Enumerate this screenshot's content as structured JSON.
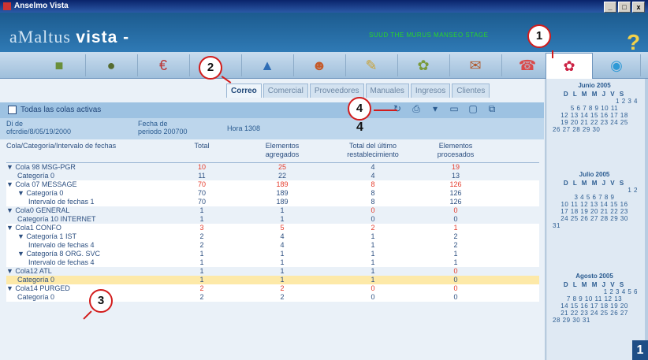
{
  "window": {
    "title": "Anselmo Vista",
    "buttons": [
      "_",
      "□",
      "x"
    ]
  },
  "header": {
    "brand_light": "aMaltus",
    "brand_bold": "vista -",
    "status_text": "SUUD THE MURUS MANSEO STAGE",
    "help": "?"
  },
  "icon_toolbar": {
    "icons": [
      "modules-icon",
      "globe-icon",
      "finance-icon",
      "folder-icon",
      "car-icon",
      "person-icon",
      "tools-icon",
      "settings-icon",
      "notes-icon",
      "calendar-icon",
      "world-icon"
    ]
  },
  "tabs": [
    "Correo",
    "Comercial",
    "Proveedores",
    "Manuales",
    "Ingresos",
    "Clientes"
  ],
  "filter_label": "Todas las colas activas",
  "info": {
    "col1": "Di de\nofcrdie/8/05/19/2000",
    "col2": "Fecha de\nperiodo 200700",
    "col3": "Hora 1308"
  },
  "table": {
    "headers": [
      "Cola/Categoría/Intervalo de fechas",
      "Total",
      "Elementos agregados",
      "Total del último restablecimiento",
      "Elementos procesados"
    ],
    "rows": [
      {
        "label": "▼ Cola 98 MSG-PGR",
        "level": 0,
        "vals": [
          "10",
          "25",
          "4",
          "19"
        ],
        "red": [
          true,
          true,
          false,
          true
        ],
        "bg": "none"
      },
      {
        "label": "Categoría 0",
        "level": 1,
        "vals": [
          "11",
          "22",
          "4",
          "13"
        ],
        "red": [
          false,
          false,
          false,
          false
        ],
        "bg": "none"
      },
      {
        "label": "▼ Cola 07 MESSAGE",
        "level": 0,
        "vals": [
          "70",
          "189",
          "8",
          "126"
        ],
        "red": [
          true,
          true,
          true,
          true
        ],
        "bg": "white"
      },
      {
        "label": "▼ Categoría 0",
        "level": 1,
        "vals": [
          "70",
          "189",
          "8",
          "126"
        ],
        "red": [
          false,
          false,
          false,
          false
        ],
        "bg": "white"
      },
      {
        "label": "Intervalo de fechas 1",
        "level": 2,
        "vals": [
          "70",
          "189",
          "8",
          "126"
        ],
        "red": [
          false,
          false,
          false,
          false
        ],
        "bg": "white"
      },
      {
        "label": "▼ Cola0 GENERAL",
        "level": 0,
        "vals": [
          "1",
          "1",
          "0",
          "0"
        ],
        "red": [
          false,
          false,
          true,
          true
        ],
        "bg": "none"
      },
      {
        "label": "Categoría 10 INTERNET",
        "level": 1,
        "vals": [
          "1",
          "1",
          "0",
          "0"
        ],
        "red": [
          false,
          false,
          false,
          false
        ],
        "bg": "none"
      },
      {
        "label": "▼ Cola1 CONFO",
        "level": 0,
        "vals": [
          "3",
          "5",
          "2",
          "1"
        ],
        "red": [
          true,
          true,
          true,
          true
        ],
        "bg": "white"
      },
      {
        "label": "▼ Categoría 1 IST",
        "level": 1,
        "vals": [
          "2",
          "4",
          "1",
          "2"
        ],
        "red": [
          false,
          false,
          false,
          false
        ],
        "bg": "white"
      },
      {
        "label": "Intervalo de fechas 4",
        "level": 2,
        "vals": [
          "2",
          "4",
          "1",
          "2"
        ],
        "red": [
          false,
          false,
          false,
          false
        ],
        "bg": "white"
      },
      {
        "label": "▼ Categoría 8 ORG. SVC",
        "level": 1,
        "vals": [
          "1",
          "1",
          "1",
          "1"
        ],
        "red": [
          false,
          false,
          false,
          false
        ],
        "bg": "white"
      },
      {
        "label": "Intervalo de fechas 4",
        "level": 2,
        "vals": [
          "1",
          "1",
          "1",
          "1"
        ],
        "red": [
          false,
          false,
          false,
          false
        ],
        "bg": "white"
      },
      {
        "label": "▼ Cola12 ATL",
        "level": 0,
        "vals": [
          "1",
          "1",
          "1",
          "0"
        ],
        "red": [
          false,
          false,
          false,
          true
        ],
        "bg": "none"
      },
      {
        "label": "Categoría 0",
        "level": 1,
        "vals": [
          "1",
          "1",
          "1",
          "0"
        ],
        "red": [
          false,
          false,
          false,
          false
        ],
        "bg": "sel"
      },
      {
        "label": "▼ Cola14 PURGED",
        "level": 0,
        "vals": [
          "2",
          "2",
          "0",
          "0"
        ],
        "red": [
          true,
          true,
          true,
          true
        ],
        "bg": "white"
      },
      {
        "label": "Categoría 0",
        "level": 1,
        "vals": [
          "2",
          "2",
          "0",
          "0"
        ],
        "red": [
          false,
          false,
          false,
          false
        ],
        "bg": "white"
      }
    ]
  },
  "calendar": {
    "day_header": "D L M M J V S",
    "months": [
      {
        "title": "Junio 2005",
        "weeks": [
          "1 2 3 4",
          "5 6 7 8 9 10 11",
          "12 13 14 15 16 17 18",
          "19 20 21 22 23 24 25",
          "26 27 28 29 30"
        ]
      },
      {
        "title": "Julio 2005",
        "weeks": [
          "1 2",
          "3 4 5 6 7 8 9",
          "10 11 12 13 14 15 16",
          "17 18 19 20 21 22 23",
          "24 25 26 27 28 29 30",
          "31"
        ]
      },
      {
        "title": "Agosto 2005",
        "weeks": [
          "1 2 3 4 5 6",
          "7 8 9 10 11 12 13",
          "14 15 16 17 18 19 20",
          "21 22 23 24 25 26 27",
          "28 29 30 31"
        ]
      }
    ]
  },
  "callouts": [
    "1",
    "2",
    "3",
    "4"
  ],
  "toolbar_caption": "4",
  "page_badge": "1",
  "colors": {
    "accent": "#2f7ab5",
    "marker_red": "#d21c1c",
    "selected_row": "#fde9a8",
    "value_red": "#e53c2c"
  }
}
